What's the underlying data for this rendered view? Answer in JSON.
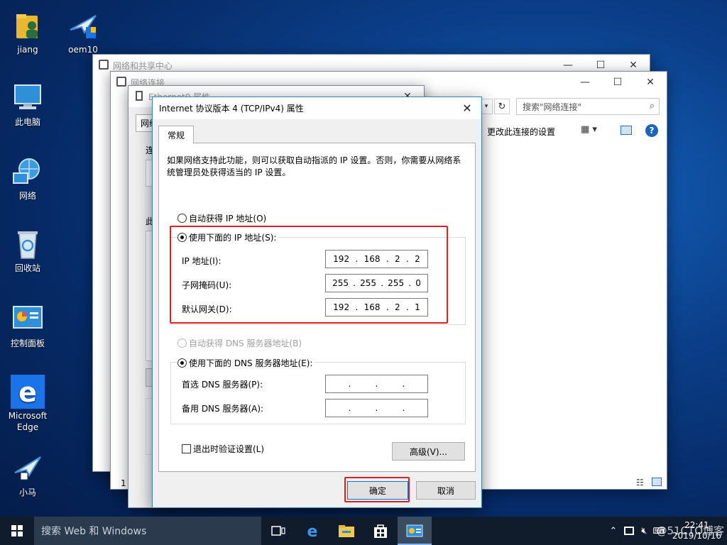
{
  "desktop": {
    "icons": [
      {
        "label": "jiang",
        "icon": "user-folder-icon"
      },
      {
        "label": "oem10",
        "icon": "bird-shortcut-icon"
      },
      {
        "label": "此电脑",
        "icon": "computer-icon"
      },
      {
        "label": "网络",
        "icon": "network-icon"
      },
      {
        "label": "回收站",
        "icon": "recycle-bin-icon"
      },
      {
        "label": "控制面板",
        "icon": "control-panel-icon"
      },
      {
        "label": "Microsoft Edge",
        "icon": "edge-icon"
      },
      {
        "label": "小马",
        "icon": "bird-shortcut-icon"
      }
    ]
  },
  "windows": {
    "sharing_center": {
      "title": "网络和共享中心"
    },
    "network_connections": {
      "title": "网络连接",
      "search_placeholder": "搜索\"网络连接\"",
      "toolbar_change_settings": "更改此连接的设置",
      "status_count": "1"
    },
    "ethernet_props": {
      "title": "Ethernet0 属性",
      "tab": "网络",
      "text_1": "连",
      "text_2": "此"
    }
  },
  "dialog": {
    "title": "Internet 协议版本 4 (TCP/IPv4) 属性",
    "tab_general": "常规",
    "description": "如果网络支持此功能，则可以获取自动指派的 IP 设置。否则，你需要从网络系统管理员处获得适当的 IP 设置。",
    "auto_ip_label": "自动获得 IP 地址(O)",
    "manual_ip_label": "使用下面的 IP 地址(S):",
    "ip_label": "IP 地址(I):",
    "subnet_label": "子网掩码(U):",
    "gateway_label": "默认网关(D):",
    "ip_address": [
      "192",
      "168",
      "2",
      "2"
    ],
    "subnet_mask": [
      "255",
      "255",
      "255",
      "0"
    ],
    "gateway": [
      "192",
      "168",
      "2",
      "1"
    ],
    "auto_dns_label": "自动获得 DNS 服务器地址(B)",
    "manual_dns_label": "使用下面的 DNS 服务器地址(E):",
    "preferred_dns_label": "首选 DNS 服务器(P):",
    "alternate_dns_label": "备用 DNS 服务器(A):",
    "preferred_dns": [
      "",
      "",
      "",
      ""
    ],
    "alternate_dns": [
      "",
      "",
      "",
      ""
    ],
    "validate_label": "退出时验证设置(L)",
    "advanced_label": "高级(V)...",
    "ok_label": "确定",
    "cancel_label": "取消",
    "highlight_color": "#e02020"
  },
  "taskbar": {
    "search_placeholder": "搜索 Web 和 Windows",
    "time": "22:41",
    "date": "2019/10/16",
    "watermark": "@51CTO博客"
  }
}
